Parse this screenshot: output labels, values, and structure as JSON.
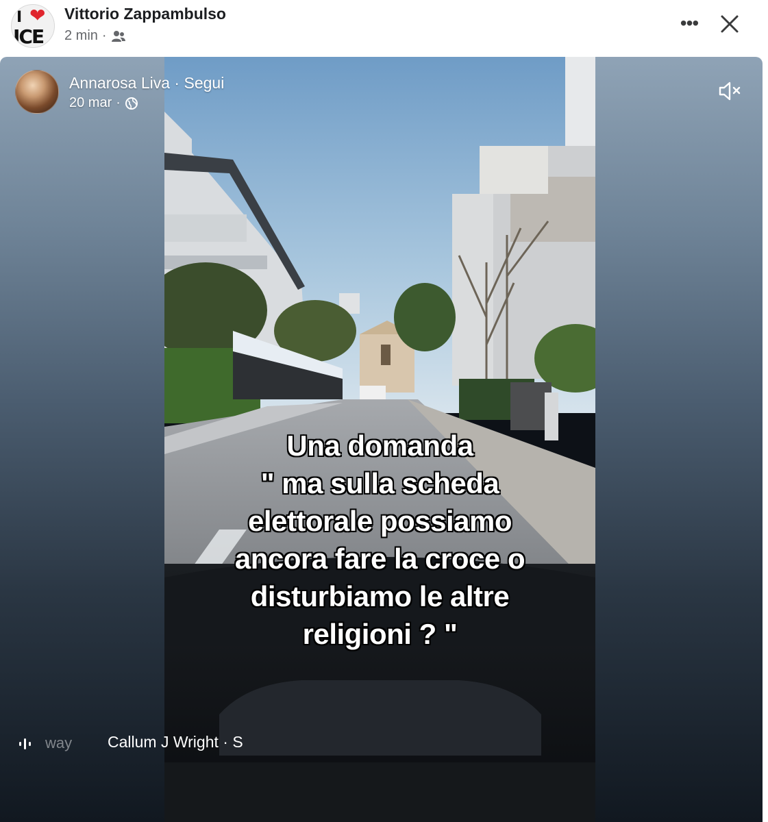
{
  "post": {
    "author": "Vittorio Zappambulso",
    "time": "2 min",
    "separator": "·",
    "audience_icon": "friends-icon",
    "more_label": "•••",
    "close_icon": "close-icon",
    "avatar_logo": {
      "top": "I",
      "heart": "❤",
      "bottom": "ICE"
    }
  },
  "shared_video": {
    "author": "Annarosa Liva",
    "dot": " · ",
    "follow_label": "Segui",
    "date": "20 mar",
    "separator": "·",
    "privacy_icon": "globe-icon",
    "mute_icon": "muted-speaker-icon",
    "overlay_lines": [
      "Una domanda",
      "\" ma sulla scheda",
      "elettorale possiamo",
      "ancora fare la croce o",
      "disturbiamo le altre",
      "religioni ? \""
    ],
    "audio": {
      "icon": "audio-waveform-icon",
      "faded_text": "way",
      "track": "Callum J Wright · S"
    }
  }
}
